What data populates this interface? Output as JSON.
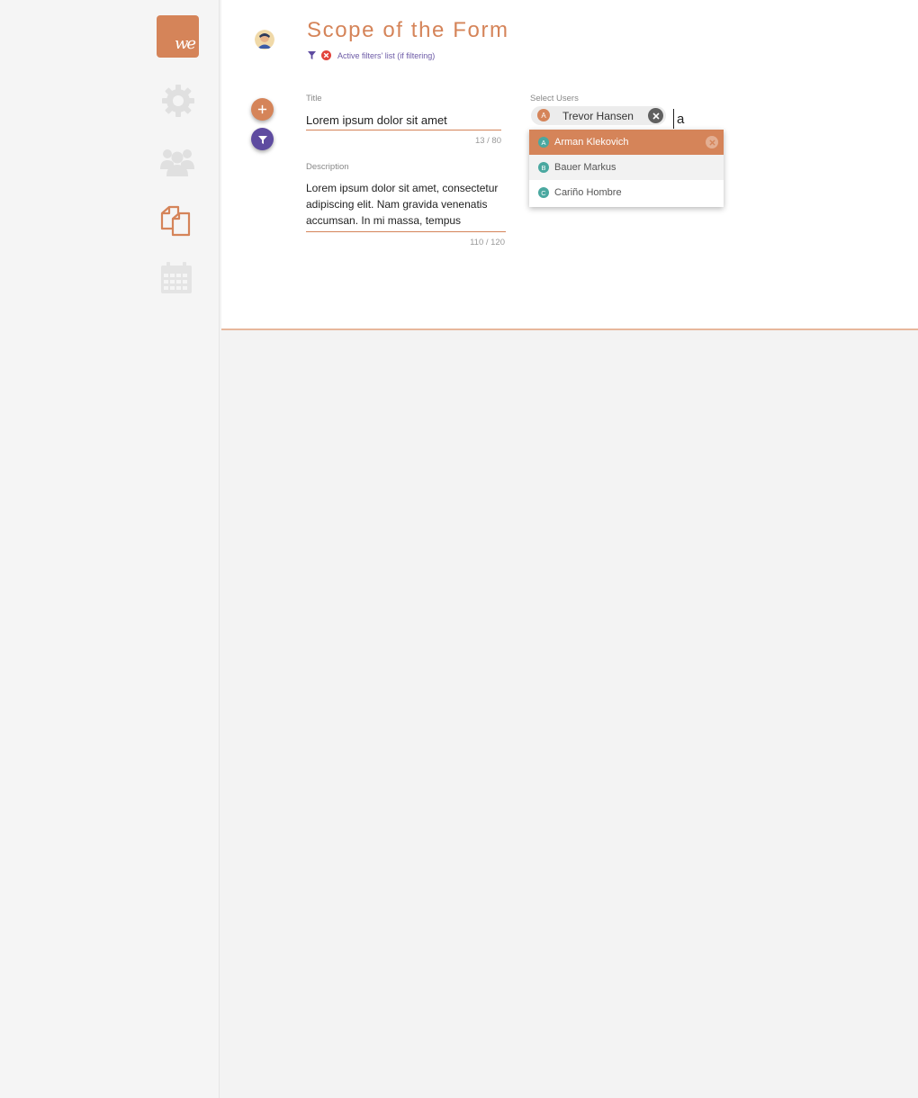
{
  "sidebar": {
    "logo_text": "we",
    "items": [
      {
        "icon": "gear-icon"
      },
      {
        "icon": "users-icon"
      },
      {
        "icon": "documents-icon"
      },
      {
        "icon": "calendar-icon"
      }
    ]
  },
  "header": {
    "title": "Scope of the Form",
    "filters_text": "Active filters' list (if filtering)"
  },
  "form": {
    "title_label": "Title",
    "title_value": "Lorem ipsum dolor sit amet",
    "title_counter": "13 / 80",
    "description_label": "Description",
    "description_value": "Lorem ipsum dolor sit amet, consectetur adipiscing elit. Nam gravida venenatis accumsan. In mi massa, tempus",
    "description_counter": "110 / 120",
    "users_label": "Select Users",
    "selected_user": {
      "initial": "A",
      "name": "Trevor Hansen"
    },
    "users_query": "a",
    "suggestions": [
      {
        "initial": "A",
        "name": "Arman Klekovich"
      },
      {
        "initial": "B",
        "name": "Bauer Markus"
      },
      {
        "initial": "C",
        "name": "Cariño Hombre"
      }
    ]
  },
  "colors": {
    "accent": "#d58459",
    "secondary": "#5e4ba0",
    "badge": "#4aa8a0"
  }
}
